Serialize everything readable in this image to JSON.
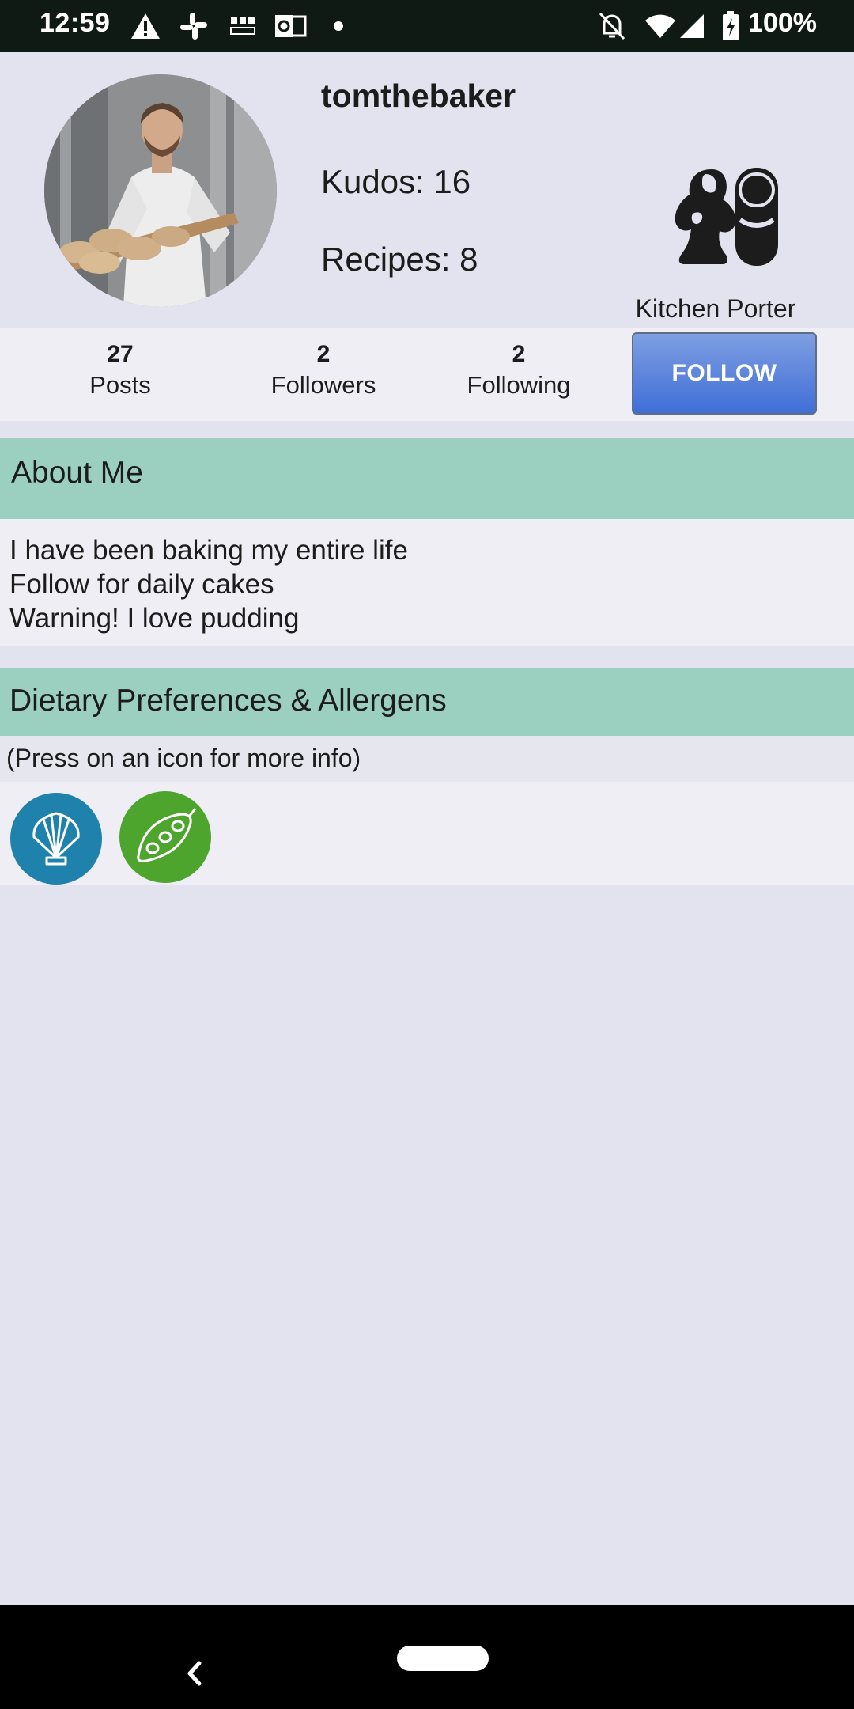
{
  "status_bar": {
    "time": "12:59",
    "battery": "100%",
    "icons": [
      "warning-icon",
      "slack-icon",
      "bbc-news-icon",
      "outlook-icon",
      "dot-icon",
      "notifications-off-icon",
      "wifi-icon",
      "signal-icon",
      "battery-charging-icon"
    ]
  },
  "profile": {
    "username": "tomthebaker",
    "kudos": "Kudos: 16",
    "recipes": "Recipes: 8",
    "rank_icon": "kitchen-porter-icon",
    "rank_label": "Kitchen Porter"
  },
  "stats": [
    {
      "value": "27",
      "label": "Posts"
    },
    {
      "value": "2",
      "label": "Followers"
    },
    {
      "value": "2",
      "label": "Following"
    }
  ],
  "follow_button": {
    "label": "FOLLOW",
    "color": "#4f78da"
  },
  "about": {
    "title": "About Me",
    "lines": [
      "I have been baking my entire life",
      "Follow for daily cakes",
      "Warning! I love pudding"
    ]
  },
  "dietary": {
    "title": "Dietary Preferences & Allergens",
    "hint": "(Press on an icon for more info)",
    "icons": [
      {
        "name": "shellfish-icon",
        "color": "#1f82ad"
      },
      {
        "name": "soya-icon",
        "color": "#4ea52e"
      }
    ]
  },
  "colors": {
    "section_header": "#9bcfbf",
    "background": "#e3e3ef",
    "status_bar": "#0f1a14"
  },
  "nav_bar": {
    "icons": [
      "back-icon",
      "home-pill-icon"
    ]
  }
}
